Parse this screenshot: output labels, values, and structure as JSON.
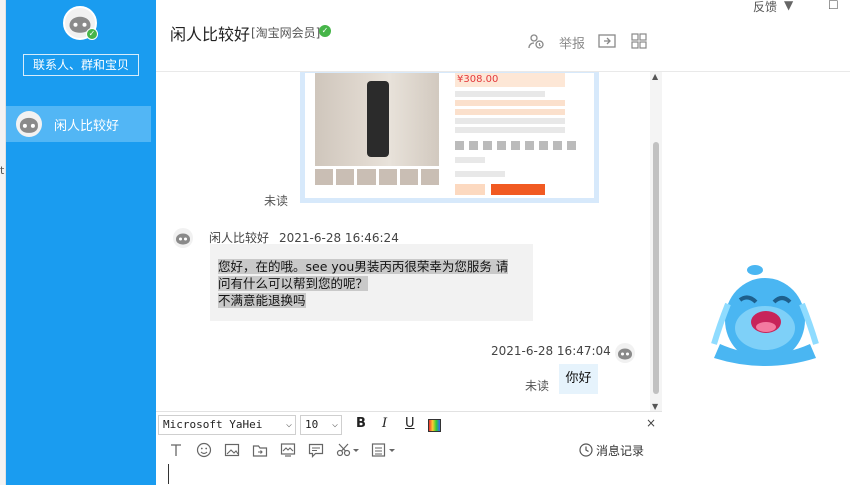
{
  "left_strip": {
    "fragment": "t"
  },
  "sidebar": {
    "search_label": "联系人、群和宝贝",
    "contact": {
      "name": "闲人比较好"
    }
  },
  "header": {
    "title": "闲人比较好",
    "member_tag": "[淘宝网会员]",
    "report_label": "举报",
    "feedback_label": "反馈",
    "min_label": "▼",
    "max_label": "☐"
  },
  "chat": {
    "product": {
      "price": "¥308.00"
    },
    "unread_label": "未读",
    "incoming": {
      "sender": "闲人比较好",
      "time": "2021-6-28 16:46:24",
      "line1": "您好，在的哦。see you男装丙丙很荣幸为您服务 请",
      "line2": "问有什么可以帮到您的呢？",
      "line3": "不满意能退换吗"
    },
    "outgoing": {
      "time": "2021-6-28 16:47:04",
      "text": "你好",
      "unread_label": "未读"
    }
  },
  "input": {
    "font_name": "Microsoft YaHei",
    "font_size": "10",
    "bold": "B",
    "italic": "I",
    "underline": "U",
    "close": "×",
    "history_label": "消息记录"
  },
  "colors": {
    "sidebar_bg": "#1a9cf0",
    "sidebar_active": "#52b6f5",
    "price_red": "#e4393c",
    "buy_orange": "#f15a22"
  }
}
